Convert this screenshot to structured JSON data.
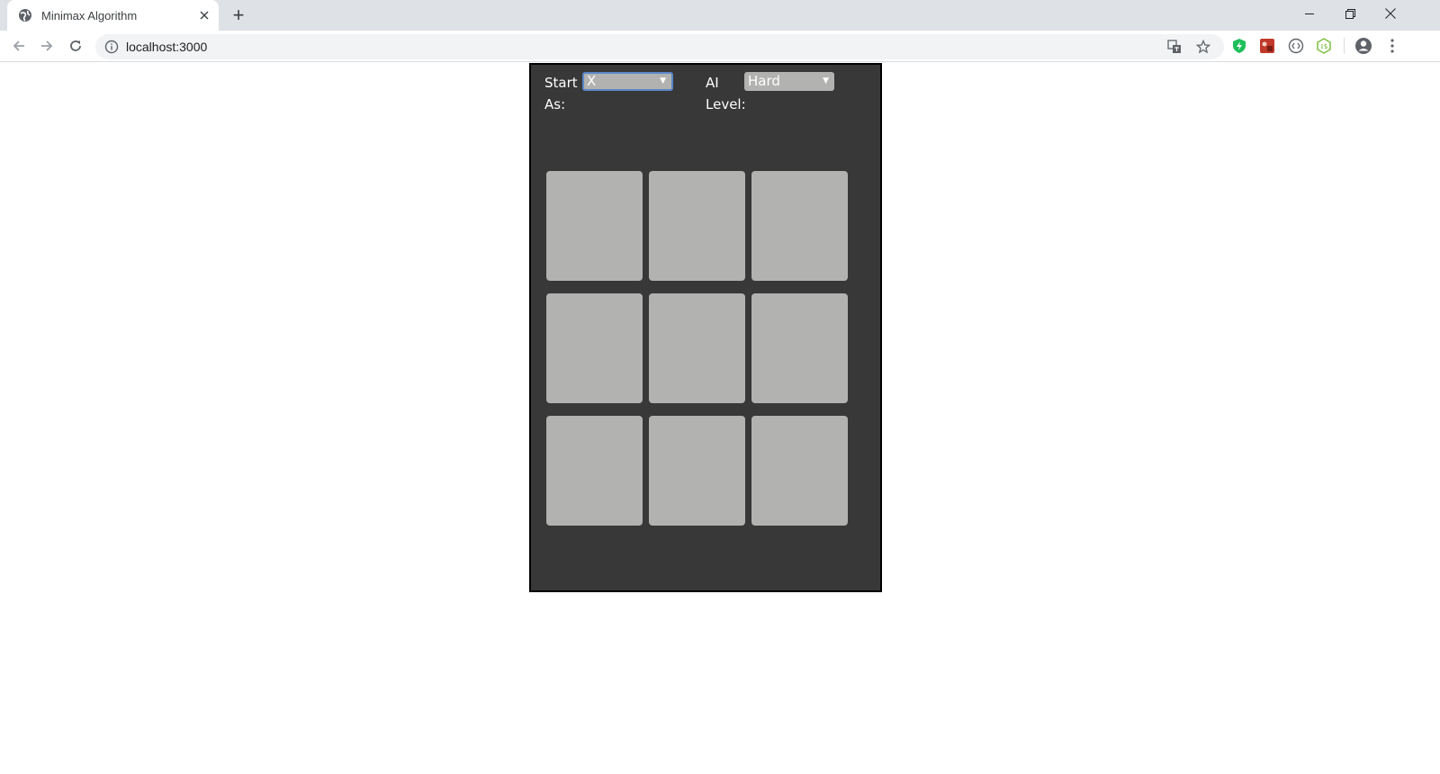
{
  "browser": {
    "tab_title": "Minimax Algorithm",
    "new_tab_label": "+",
    "url": "localhost:3000"
  },
  "game": {
    "start_as_label_1": "Start",
    "start_as_label_2": "As:",
    "start_as_value": "X",
    "ai_level_label_1": "AI",
    "ai_level_label_2": "Level:",
    "ai_level_value": "Hard",
    "board": [
      "",
      "",
      "",
      "",
      "",
      "",
      "",
      "",
      ""
    ]
  },
  "icons": {
    "tab_favicon": "globe-icon",
    "omnibox_info": "info-icon",
    "translate": "translate-icon",
    "bookmark": "star-icon",
    "extensions": [
      "shield-extension-icon",
      "puzzle-game-extension-icon",
      "code-extension-icon",
      "nodejs-extension-icon"
    ],
    "profile": "profile-icon",
    "menu": "more-vert-icon"
  },
  "colors": {
    "app_background": "#383838",
    "cell_color": "#b2b3b0",
    "select_focus": "#5b86c9"
  }
}
